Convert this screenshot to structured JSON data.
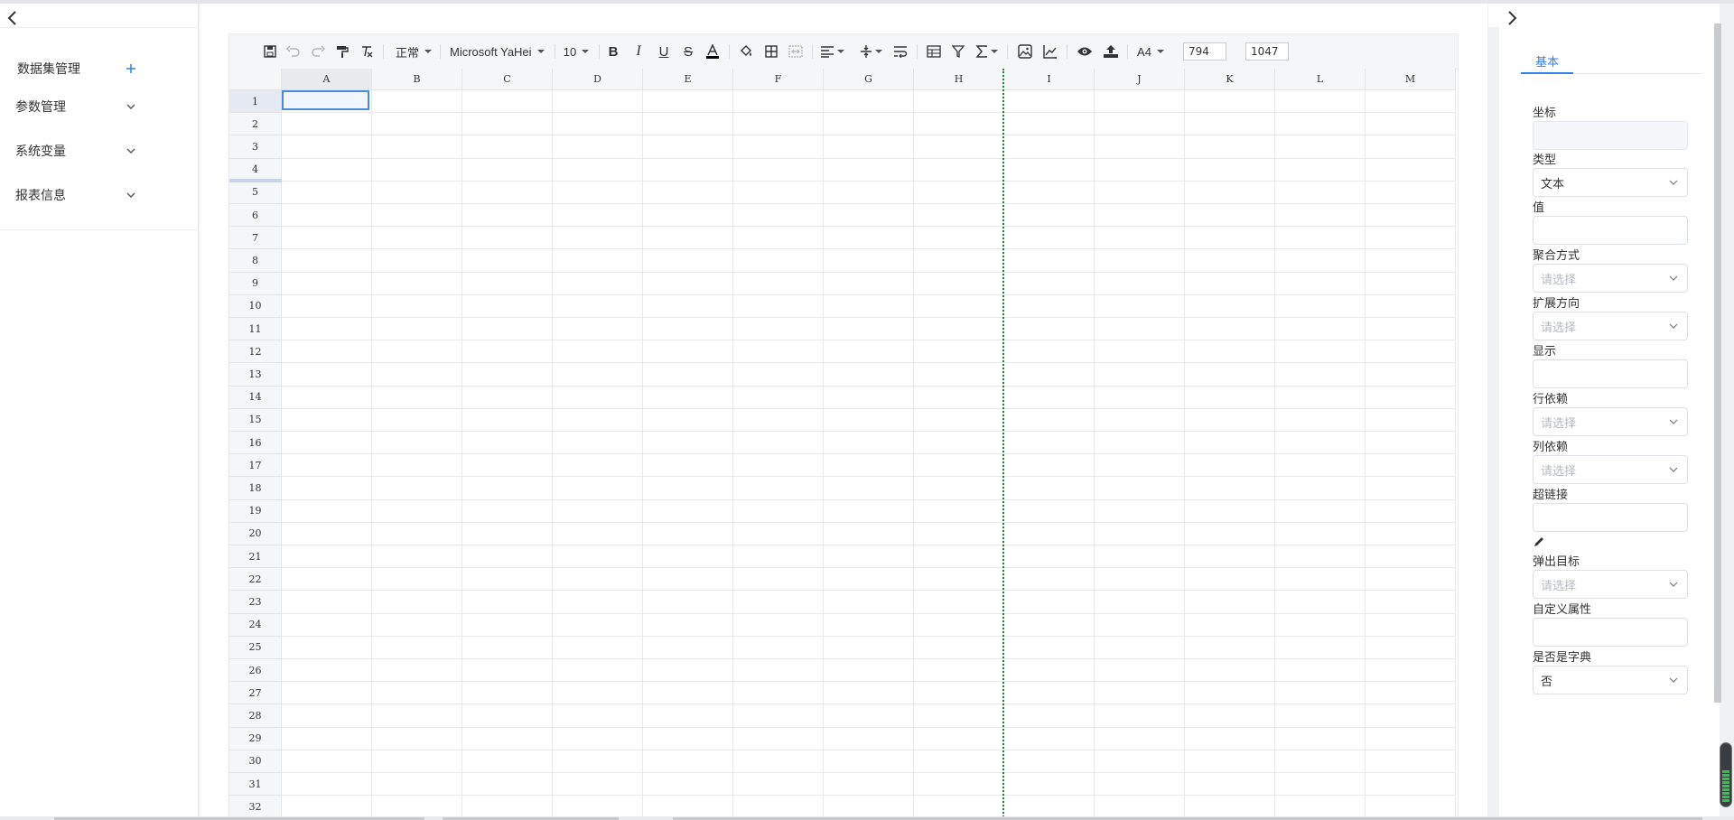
{
  "left_panel": {
    "items": [
      {
        "label": "数据集管理",
        "icon": "plus-icon"
      },
      {
        "label": "参数管理",
        "icon": "chevron-down-icon"
      },
      {
        "label": "系统变量",
        "icon": "chevron-down-icon"
      },
      {
        "label": "报表信息",
        "icon": "chevron-down-icon"
      }
    ]
  },
  "toolbar": {
    "style_select": "正常",
    "font_family": "Microsoft YaHei",
    "font_size": "10",
    "paper_size": "A4",
    "width_value": "794",
    "height_value": "1047"
  },
  "sheet": {
    "columns": [
      "A",
      "B",
      "C",
      "D",
      "E",
      "F",
      "G",
      "H",
      "I",
      "J",
      "K",
      "L",
      "M"
    ],
    "rows": [
      "1",
      "2",
      "3",
      "4",
      "5",
      "6",
      "7",
      "8",
      "9",
      "10",
      "11",
      "12",
      "13",
      "14",
      "15",
      "16",
      "17",
      "18",
      "19",
      "20",
      "21",
      "22",
      "23",
      "24",
      "25",
      "26",
      "27",
      "28",
      "29",
      "30",
      "31",
      "32"
    ],
    "selected_cell": "A1"
  },
  "right_panel": {
    "tab": "基本",
    "fields": {
      "coord_label": "坐标",
      "type_label": "类型",
      "type_value": "文本",
      "value_label": "值",
      "agg_label": "聚合方式",
      "agg_placeholder": "请选择",
      "expand_label": "扩展方向",
      "expand_placeholder": "请选择",
      "display_label": "显示",
      "rowdep_label": "行依赖",
      "rowdep_placeholder": "请选择",
      "coldep_label": "列依赖",
      "coldep_placeholder": "请选择",
      "link_label": "超链接",
      "popup_label": "弹出目标",
      "popup_placeholder": "请选择",
      "custom_label": "自定义属性",
      "dict_label": "是否是字典",
      "dict_value": "否"
    }
  },
  "colors": {
    "accent": "#2f80ed",
    "selection": "#4b89dc",
    "pagebreak": "#1a8a2a"
  }
}
